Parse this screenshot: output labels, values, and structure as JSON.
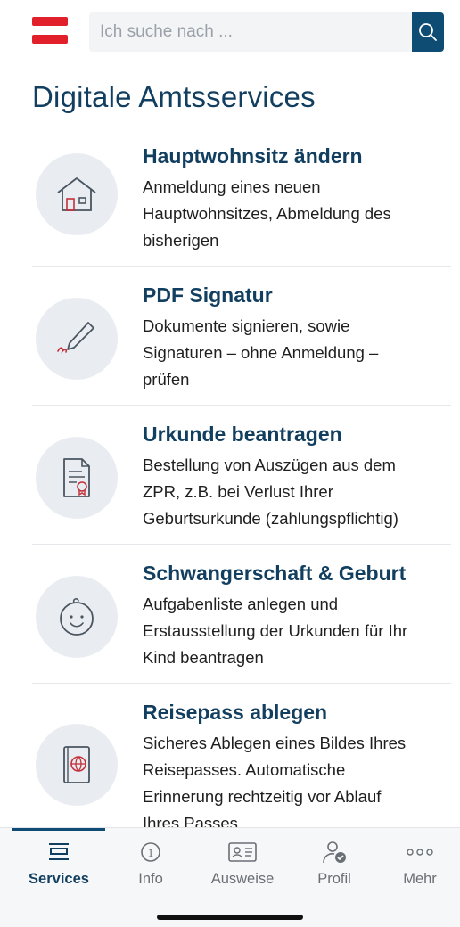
{
  "search": {
    "placeholder": "Ich suche nach ..."
  },
  "page": {
    "title": "Digitale Amtsservices"
  },
  "services": [
    {
      "title": "Hauptwohnsitz ändern",
      "lines": [
        "Anmeldung eines neuen",
        "Hauptwohnsitzes, Abmeldung des",
        "bisherigen"
      ],
      "icon": "house-icon"
    },
    {
      "title": "PDF Signatur",
      "lines": [
        "Dokumente signieren, sowie",
        "Signaturen – ohne Anmeldung –",
        "prüfen"
      ],
      "icon": "signature-pen-icon"
    },
    {
      "title": "Urkunde beantragen",
      "lines": [
        "Bestellung von Auszügen aus dem",
        "ZPR, z.B. bei Verlust Ihrer",
        "Geburtsurkunde (zahlungspflichtig)"
      ],
      "icon": "certificate-document-icon"
    },
    {
      "title": "Schwangerschaft & Geburt",
      "lines": [
        "Aufgabenliste anlegen und",
        "Erstausstellung der Urkunden für Ihr",
        "Kind beantragen"
      ],
      "icon": "baby-face-icon"
    },
    {
      "title": "Reisepass ablegen",
      "lines": [
        "Sicheres Ablegen eines Bildes Ihres",
        "Reisepasses. Automatische",
        "Erinnerung rechtzeitig vor Ablauf",
        "Ihres Passes"
      ],
      "icon": "passport-icon"
    }
  ],
  "nav": {
    "tabs": [
      {
        "label": "Services",
        "icon": "services-icon",
        "active": true
      },
      {
        "label": "Info",
        "icon": "info-icon",
        "active": false
      },
      {
        "label": "Ausweise",
        "icon": "id-card-icon",
        "active": false
      },
      {
        "label": "Profil",
        "icon": "profile-icon",
        "active": false
      },
      {
        "label": "Mehr",
        "icon": "more-dots-icon",
        "active": false
      }
    ]
  },
  "colors": {
    "brand": "#123f60",
    "accent": "#0f4c73",
    "flag_red": "#e2202c"
  }
}
